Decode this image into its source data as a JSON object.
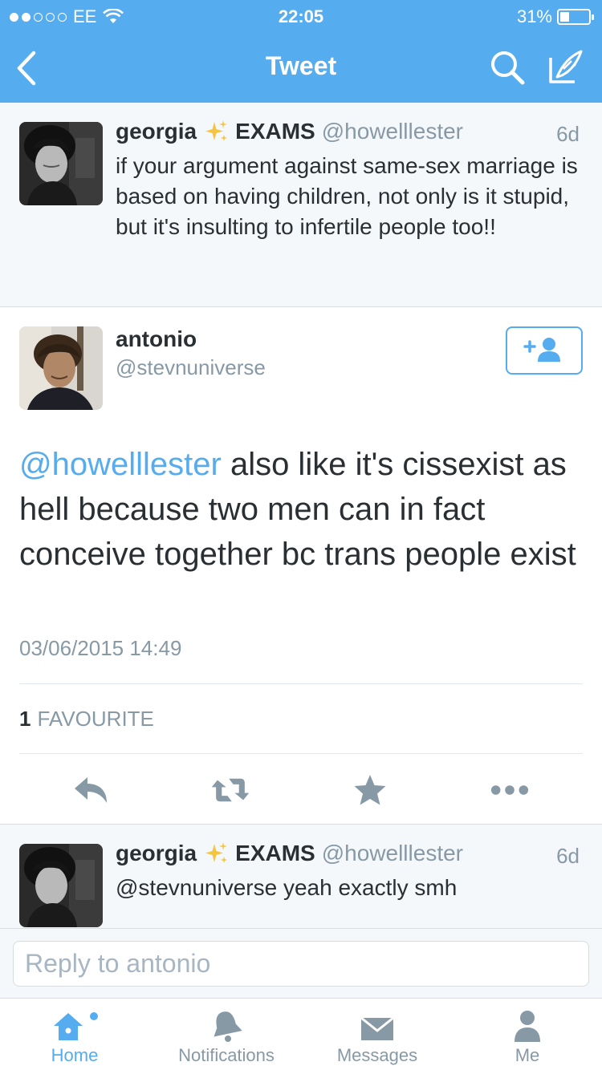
{
  "status_bar": {
    "carrier": "EE",
    "time": "22:05",
    "battery": "31%",
    "battery_level": 0.31
  },
  "nav": {
    "title": "Tweet"
  },
  "parent_tweet": {
    "name": "georgia",
    "name_suffix": "EXAMS",
    "handle": "@howelllester",
    "time": "6d",
    "text": "if your argument against same-sex marriage is based on having children, not only is it stupid, but it's insulting to infertile people too!!"
  },
  "main_tweet": {
    "name": "antonio",
    "handle": "@stevnuniverse",
    "mention": "@howelllester",
    "text": " also like it's cissexist as hell because two men can in fact conceive together bc trans people exist",
    "date": "03/06/2015 14:49",
    "favourite_count": "1",
    "favourite_label": "FAVOURITE"
  },
  "reply_tweet": {
    "name": "georgia",
    "name_suffix": "EXAMS",
    "handle": "@howelllester",
    "time": "6d",
    "text": "@stevnuniverse yeah exactly smh"
  },
  "reply_box": {
    "placeholder": "Reply to antonio"
  },
  "tabs": [
    {
      "label": "Home",
      "icon": "home-icon",
      "active": true
    },
    {
      "label": "Notifications",
      "icon": "bell-icon",
      "active": false
    },
    {
      "label": "Messages",
      "icon": "envelope-icon",
      "active": false
    },
    {
      "label": "Me",
      "icon": "person-icon",
      "active": false
    }
  ],
  "colors": {
    "brand": "#55acee",
    "text": "#292f33",
    "muted": "#8899a6",
    "background_alt": "#f5f8fa"
  }
}
